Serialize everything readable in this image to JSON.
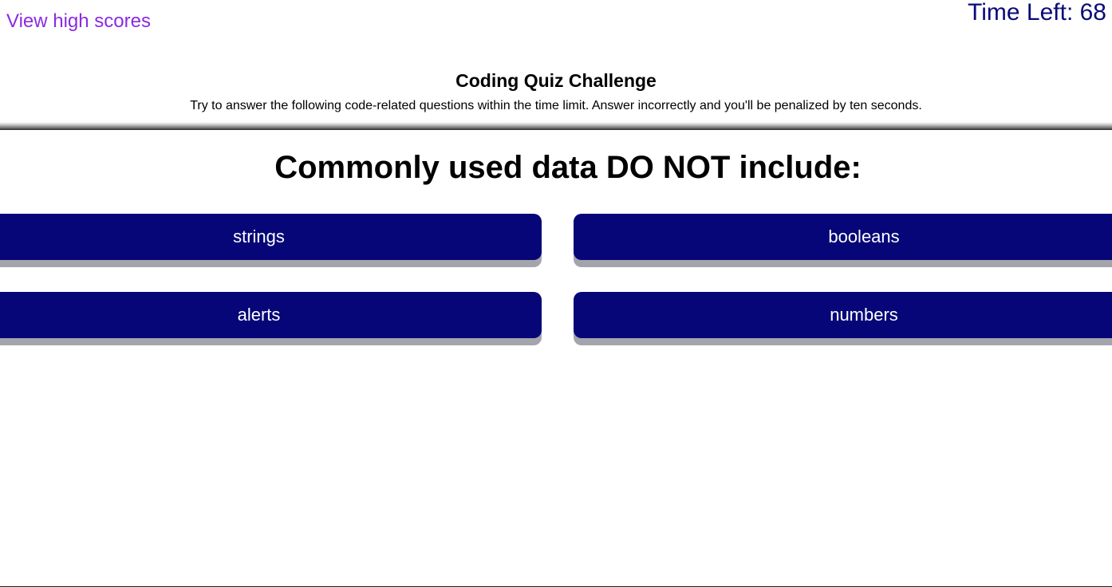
{
  "nav": {
    "high_scores_label": "View high scores"
  },
  "timer": {
    "label": "Time Left: 68"
  },
  "header": {
    "title": "Coding Quiz Challenge",
    "description": "Try to answer the following code-related questions within the time limit. Answer incorrectly and you'll be penalized by ten seconds."
  },
  "quiz": {
    "question": "Commonly used data DO NOT include:",
    "answers": [
      {
        "label": "strings"
      },
      {
        "label": "booleans"
      },
      {
        "label": "alerts"
      },
      {
        "label": "numbers"
      }
    ]
  },
  "colors": {
    "link": "#8a2be2",
    "timer": "#0a0a7a",
    "button_background": "#060678",
    "button_shadow": "#a4a4ac",
    "button_text": "#ffffff"
  }
}
